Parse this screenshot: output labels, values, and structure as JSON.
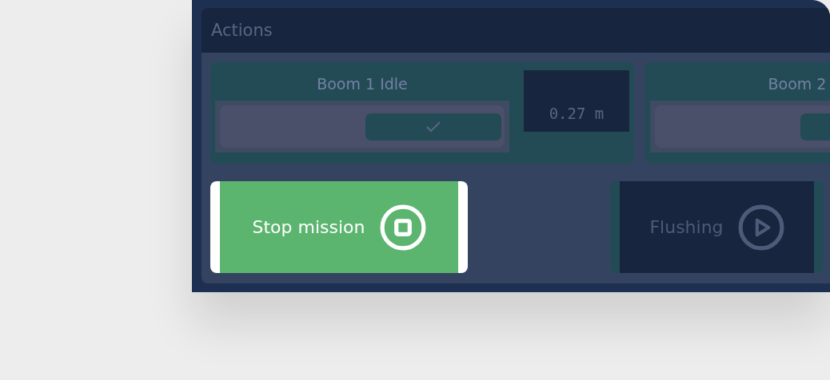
{
  "panel": {
    "title": "Actions"
  },
  "booms": [
    {
      "label": "Boom 1 Idle",
      "on": true,
      "confirmed": true,
      "reading": "0.27 m"
    },
    {
      "label": "Boom 2",
      "on": true
    }
  ],
  "actions": [
    {
      "label": "Stop mission",
      "kind": "stop",
      "active": true
    },
    {
      "label": "Flushing",
      "kind": "play",
      "active": false
    }
  ]
}
